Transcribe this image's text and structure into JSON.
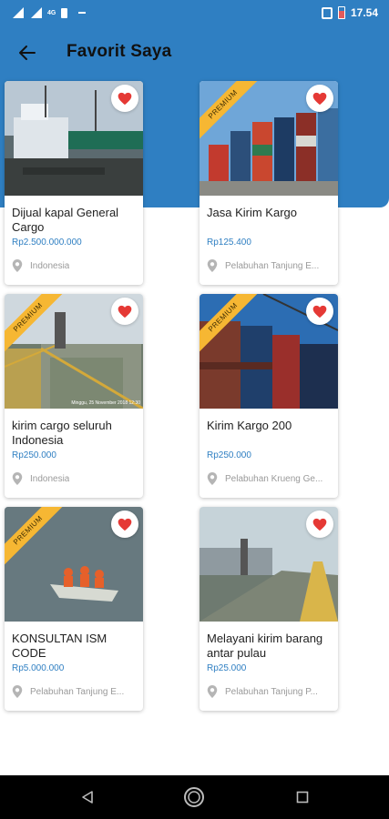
{
  "status_bar": {
    "network": "4G",
    "time": "17.54"
  },
  "header": {
    "title": "Favorit Saya",
    "back_icon": "arrow-left-icon"
  },
  "colors": {
    "primary": "#2f7fc2",
    "premium": "#f6b733",
    "heart": "#e53935"
  },
  "listings": [
    {
      "title": "Dijual kapal General Cargo",
      "price": "Rp2.500.000.000",
      "location": "Indonesia",
      "premium": false,
      "favorite": true
    },
    {
      "title": "Jasa Kirim Kargo",
      "price": "Rp125.400",
      "location": "Pelabuhan Tanjung E...",
      "premium": true,
      "favorite": true
    },
    {
      "title": "kirim cargo seluruh Indonesia",
      "price": "Rp250.000",
      "location": "Indonesia",
      "premium": true,
      "favorite": true,
      "photo_caption": "Minggu, 25 November 2018 12:30"
    },
    {
      "title": "Kirim Kargo 200",
      "price": "Rp250.000",
      "location": "Pelabuhan Krueng Ge...",
      "premium": true,
      "favorite": true
    },
    {
      "title": "KONSULTAN ISM CODE",
      "price": "Rp5.000.000",
      "location": "Pelabuhan Tanjung E...",
      "premium": true,
      "favorite": true
    },
    {
      "title": "Melayani kirim barang antar pulau",
      "price": "Rp25.000",
      "location": "Pelabuhan Tanjung P...",
      "premium": false,
      "favorite": true
    }
  ],
  "premium_label": "PREMIUM",
  "nav": {
    "back": "nav-back-icon",
    "home": "nav-home-icon",
    "recents": "nav-recents-icon"
  }
}
